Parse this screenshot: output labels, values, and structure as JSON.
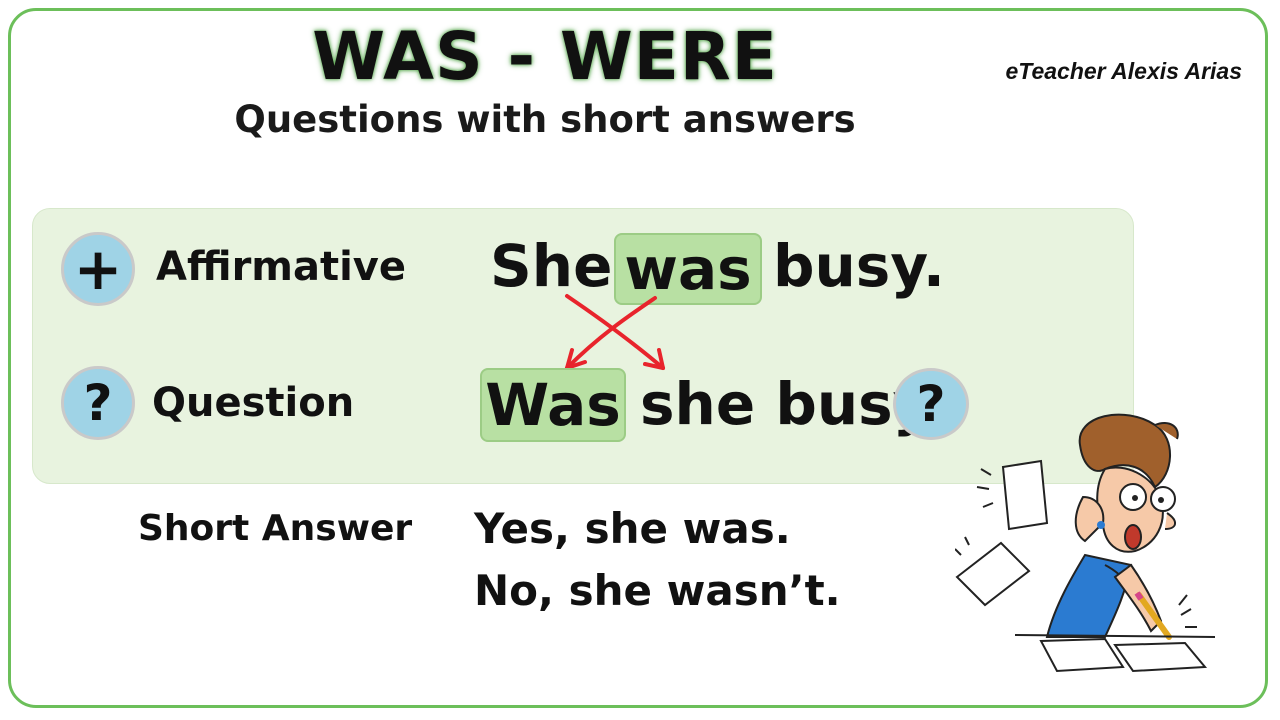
{
  "title": "WAS - WERE",
  "subtitle": "Questions with short answers",
  "author": "eTeacher Alexis Arias",
  "affirmative": {
    "icon_symbol": "+",
    "label": "Affirmative",
    "sentence_start": "She",
    "highlight": "was",
    "sentence_end": "busy."
  },
  "question": {
    "icon_symbol": "?",
    "label": "Question",
    "highlight": "Was",
    "sentence_rest": "she busy",
    "end_symbol": "?"
  },
  "short_answer": {
    "label": "Short Answer",
    "yes": "Yes, she was.",
    "no": "No, she wasn’t."
  },
  "colors": {
    "frame": "#6cbf5a",
    "panel": "#e8f3df",
    "highlight": "#b8e0a3",
    "icon_circle": "#9fd3e6",
    "arrows": "#e8242c"
  },
  "illustration": "stressed-woman-writing-cartoon"
}
